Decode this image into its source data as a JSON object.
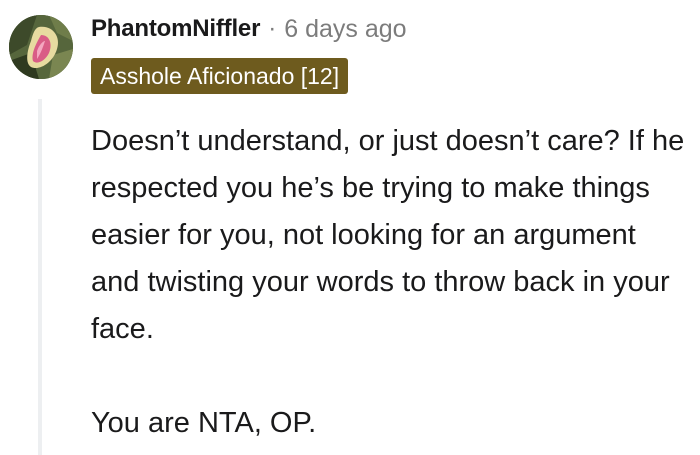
{
  "comment": {
    "author": "PhantomNiffler",
    "separator": "·",
    "timestamp": "6 days ago",
    "flair": "Asshole Aficionado [12]",
    "paragraphs": [
      "Doesn’t understand, or just doesn’t care? If he respected you he’s be trying to make things easier for you, not looking for an argument and twisting your words to throw back in your face.",
      "You are NTA, OP."
    ]
  },
  "colors": {
    "flair_background": "#6e5b1e",
    "flair_text": "#ffffff",
    "author_text": "#1a1a1b",
    "meta_text": "#7c7c7c",
    "thread_line": "#edeff1"
  },
  "icons": {
    "avatar": "user-avatar-image"
  }
}
